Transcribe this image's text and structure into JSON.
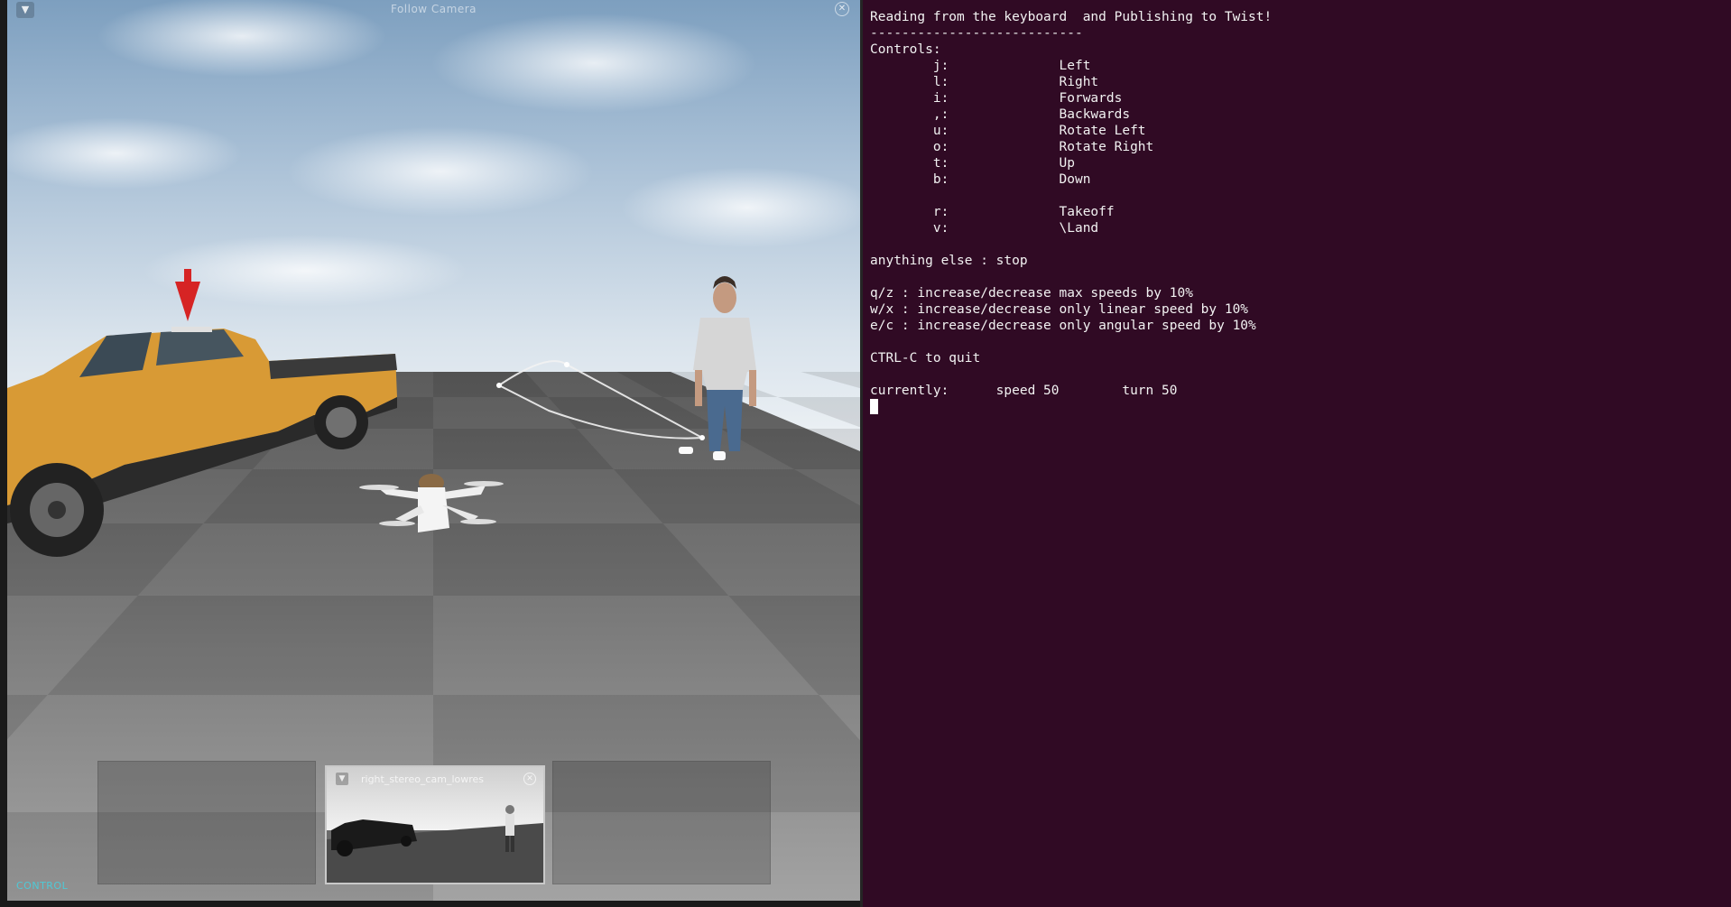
{
  "simulator": {
    "window_title": "Follow Camera",
    "menu_icon": "menu-icon",
    "close_icon": "close-icon",
    "mode_label": "CONTROL",
    "subwindow_title": "right_stereo_cam_lowres"
  },
  "terminal": {
    "lines": [
      "Reading from the keyboard  and Publishing to Twist!",
      "---------------------------",
      "Controls:",
      "        j:              Left",
      "        l:              Right",
      "        i:              Forwards",
      "        ,:              Backwards",
      "        u:              Rotate Left",
      "        o:              Rotate Right",
      "        t:              Up",
      "        b:              Down",
      "",
      "        r:              Takeoff",
      "        v:              \\Land",
      "",
      "anything else : stop",
      "",
      "q/z : increase/decrease max speeds by 10%",
      "w/x : increase/decrease only linear speed by 10%",
      "e/c : increase/decrease only angular speed by 10%",
      "",
      "CTRL-C to quit",
      "",
      "currently:      speed 50        turn 50"
    ]
  },
  "colors": {
    "terminal_bg": "#300a24",
    "control_label": "#4ec9d6",
    "vehicle": "#d89a35",
    "drone": "#f2f2f2"
  }
}
